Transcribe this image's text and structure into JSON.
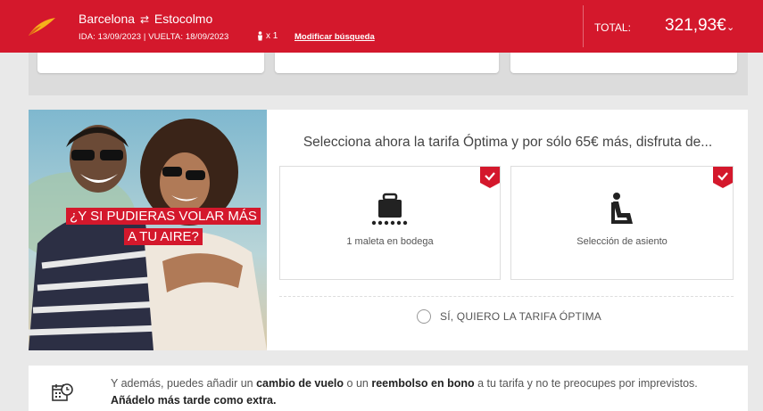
{
  "header": {
    "origin": "Barcelona",
    "route_arrow": "⇄",
    "destination": "Estocolmo",
    "dates": "IDA: 13/09/2023 | VUELTA: 18/09/2023",
    "passengers": "x 1",
    "modify_link": "Modificar búsqueda",
    "total_label": "TOTAL:",
    "total_price": "321,93€",
    "chevron": "⌄"
  },
  "upsell": {
    "tagline_line1": "¿Y SI PUDIERAS VOLAR MÁS",
    "tagline_line2": "A TU AIRE?",
    "title": "Selecciona ahora la tarifa Óptima y por sólo 65€ más, disfruta de...",
    "benefits": [
      {
        "label": "1 maleta en bodega",
        "icon": "suitcase-icon"
      },
      {
        "label": "Selección de asiento",
        "icon": "seat-icon"
      }
    ],
    "option_label": "SÍ, QUIERO LA TARIFA ÓPTIMA"
  },
  "extras": {
    "part1": "Y además, puedes añadir un ",
    "bold1": "cambio de vuelo",
    "part2": " o un ",
    "bold2": "reembolso en bono",
    "part3": " a tu tarifa y no te preocupes por imprevistos.",
    "bold3": "Añádelo más tarde como extra."
  },
  "colors": {
    "brand_red": "#d4182c",
    "logo_yellow": "#f6b21a"
  }
}
